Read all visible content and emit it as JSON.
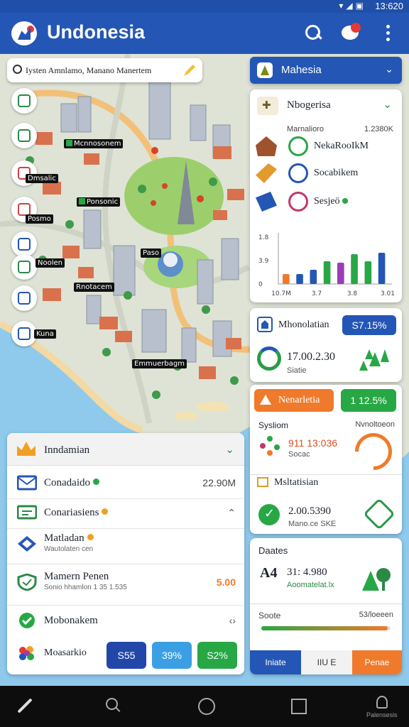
{
  "status_bar": {
    "time": "13:620"
  },
  "app": {
    "title": "Undonesia"
  },
  "map": {
    "search": {
      "value": "Iysten Amnlamo, Manano Manertem"
    },
    "labels": [
      "Mcnnosonem",
      "Dmsalic",
      "Ponsonic",
      "Paso",
      "Noolen",
      "Rnotacem",
      "Kuna",
      "Posmo",
      "Emmuerbagm"
    ]
  },
  "region_selector": {
    "label": "Mahesia"
  },
  "panel_overview": {
    "title": "Nbogerisa",
    "subtitle": "Marnalioro",
    "subtitle_value": "1.2380K",
    "items": [
      {
        "label": "NekaRooIkM"
      },
      {
        "label": "Socabikem"
      },
      {
        "label": "Sesjeö"
      }
    ],
    "chart_data": {
      "type": "bar",
      "x_ticks": [
        "10.7M",
        "3.7",
        "3.8",
        "3.01"
      ],
      "y_ticks": [
        "1.8",
        "3.9",
        "0"
      ],
      "ylim": [
        0,
        1.8
      ],
      "series_colors": [
        "#f07a2b",
        "#2456b5",
        "#28a745",
        "#9b3bb5"
      ],
      "bars": [
        {
          "v": 0.35,
          "c": 0
        },
        {
          "v": 0.35,
          "c": 1
        },
        {
          "v": 0.5,
          "c": 1
        },
        {
          "v": 0.8,
          "c": 2
        },
        {
          "v": 0.75,
          "c": 3
        },
        {
          "v": 1.05,
          "c": 2
        },
        {
          "v": 0.8,
          "c": 2
        },
        {
          "v": 1.1,
          "c": 1
        }
      ]
    }
  },
  "panel_stat1": {
    "title": "Mhonolatian",
    "pill": "S7.15%",
    "value": "17.00.2.30",
    "sub": "Siatie"
  },
  "panel_stat2": {
    "tag": "Nenarletia",
    "pill": "1 12.5%",
    "left_label": "Sysliom",
    "right_label": "Nvnoltoeon",
    "value1": "911 13:036",
    "value1_sub": "Socac",
    "section": "Msltatisian",
    "value2": "2.00.5390",
    "value2_sub": "Mano.ce SKE"
  },
  "panel_stat3": {
    "label": "Daates",
    "icon_text": "A4",
    "value": "31: 4.980",
    "sub": "Aoomatelat.lx",
    "slider_left": "Soote",
    "slider_right": "53/loeeen",
    "slider_fraction": 0.98,
    "segments": [
      "Iniate",
      "IIU E",
      "Penae"
    ]
  },
  "panel_list": {
    "title": "Inndamian",
    "rows": [
      {
        "name": "Conadaido",
        "value": "22.90M",
        "sub": ""
      },
      {
        "name": "Conariasiens",
        "value": "",
        "sub": ""
      },
      {
        "name": "Matladan",
        "value": "",
        "sub": "Wautolaten cen"
      },
      {
        "name": "Mamern Penen",
        "value": "5.00",
        "sub": "Sonio hhamlon 1 35 1.535"
      },
      {
        "name": "Mobonakem",
        "value": "",
        "sub": ""
      },
      {
        "name": "Moasarkio",
        "value": "",
        "sub": ""
      }
    ],
    "buttons": [
      "S55",
      "39%",
      "S2%"
    ]
  },
  "nav": {
    "profile_label": "Palensesis"
  },
  "colors": {
    "primary": "#2456b5",
    "accent_green": "#28a745",
    "accent_orange": "#f07a2b"
  }
}
